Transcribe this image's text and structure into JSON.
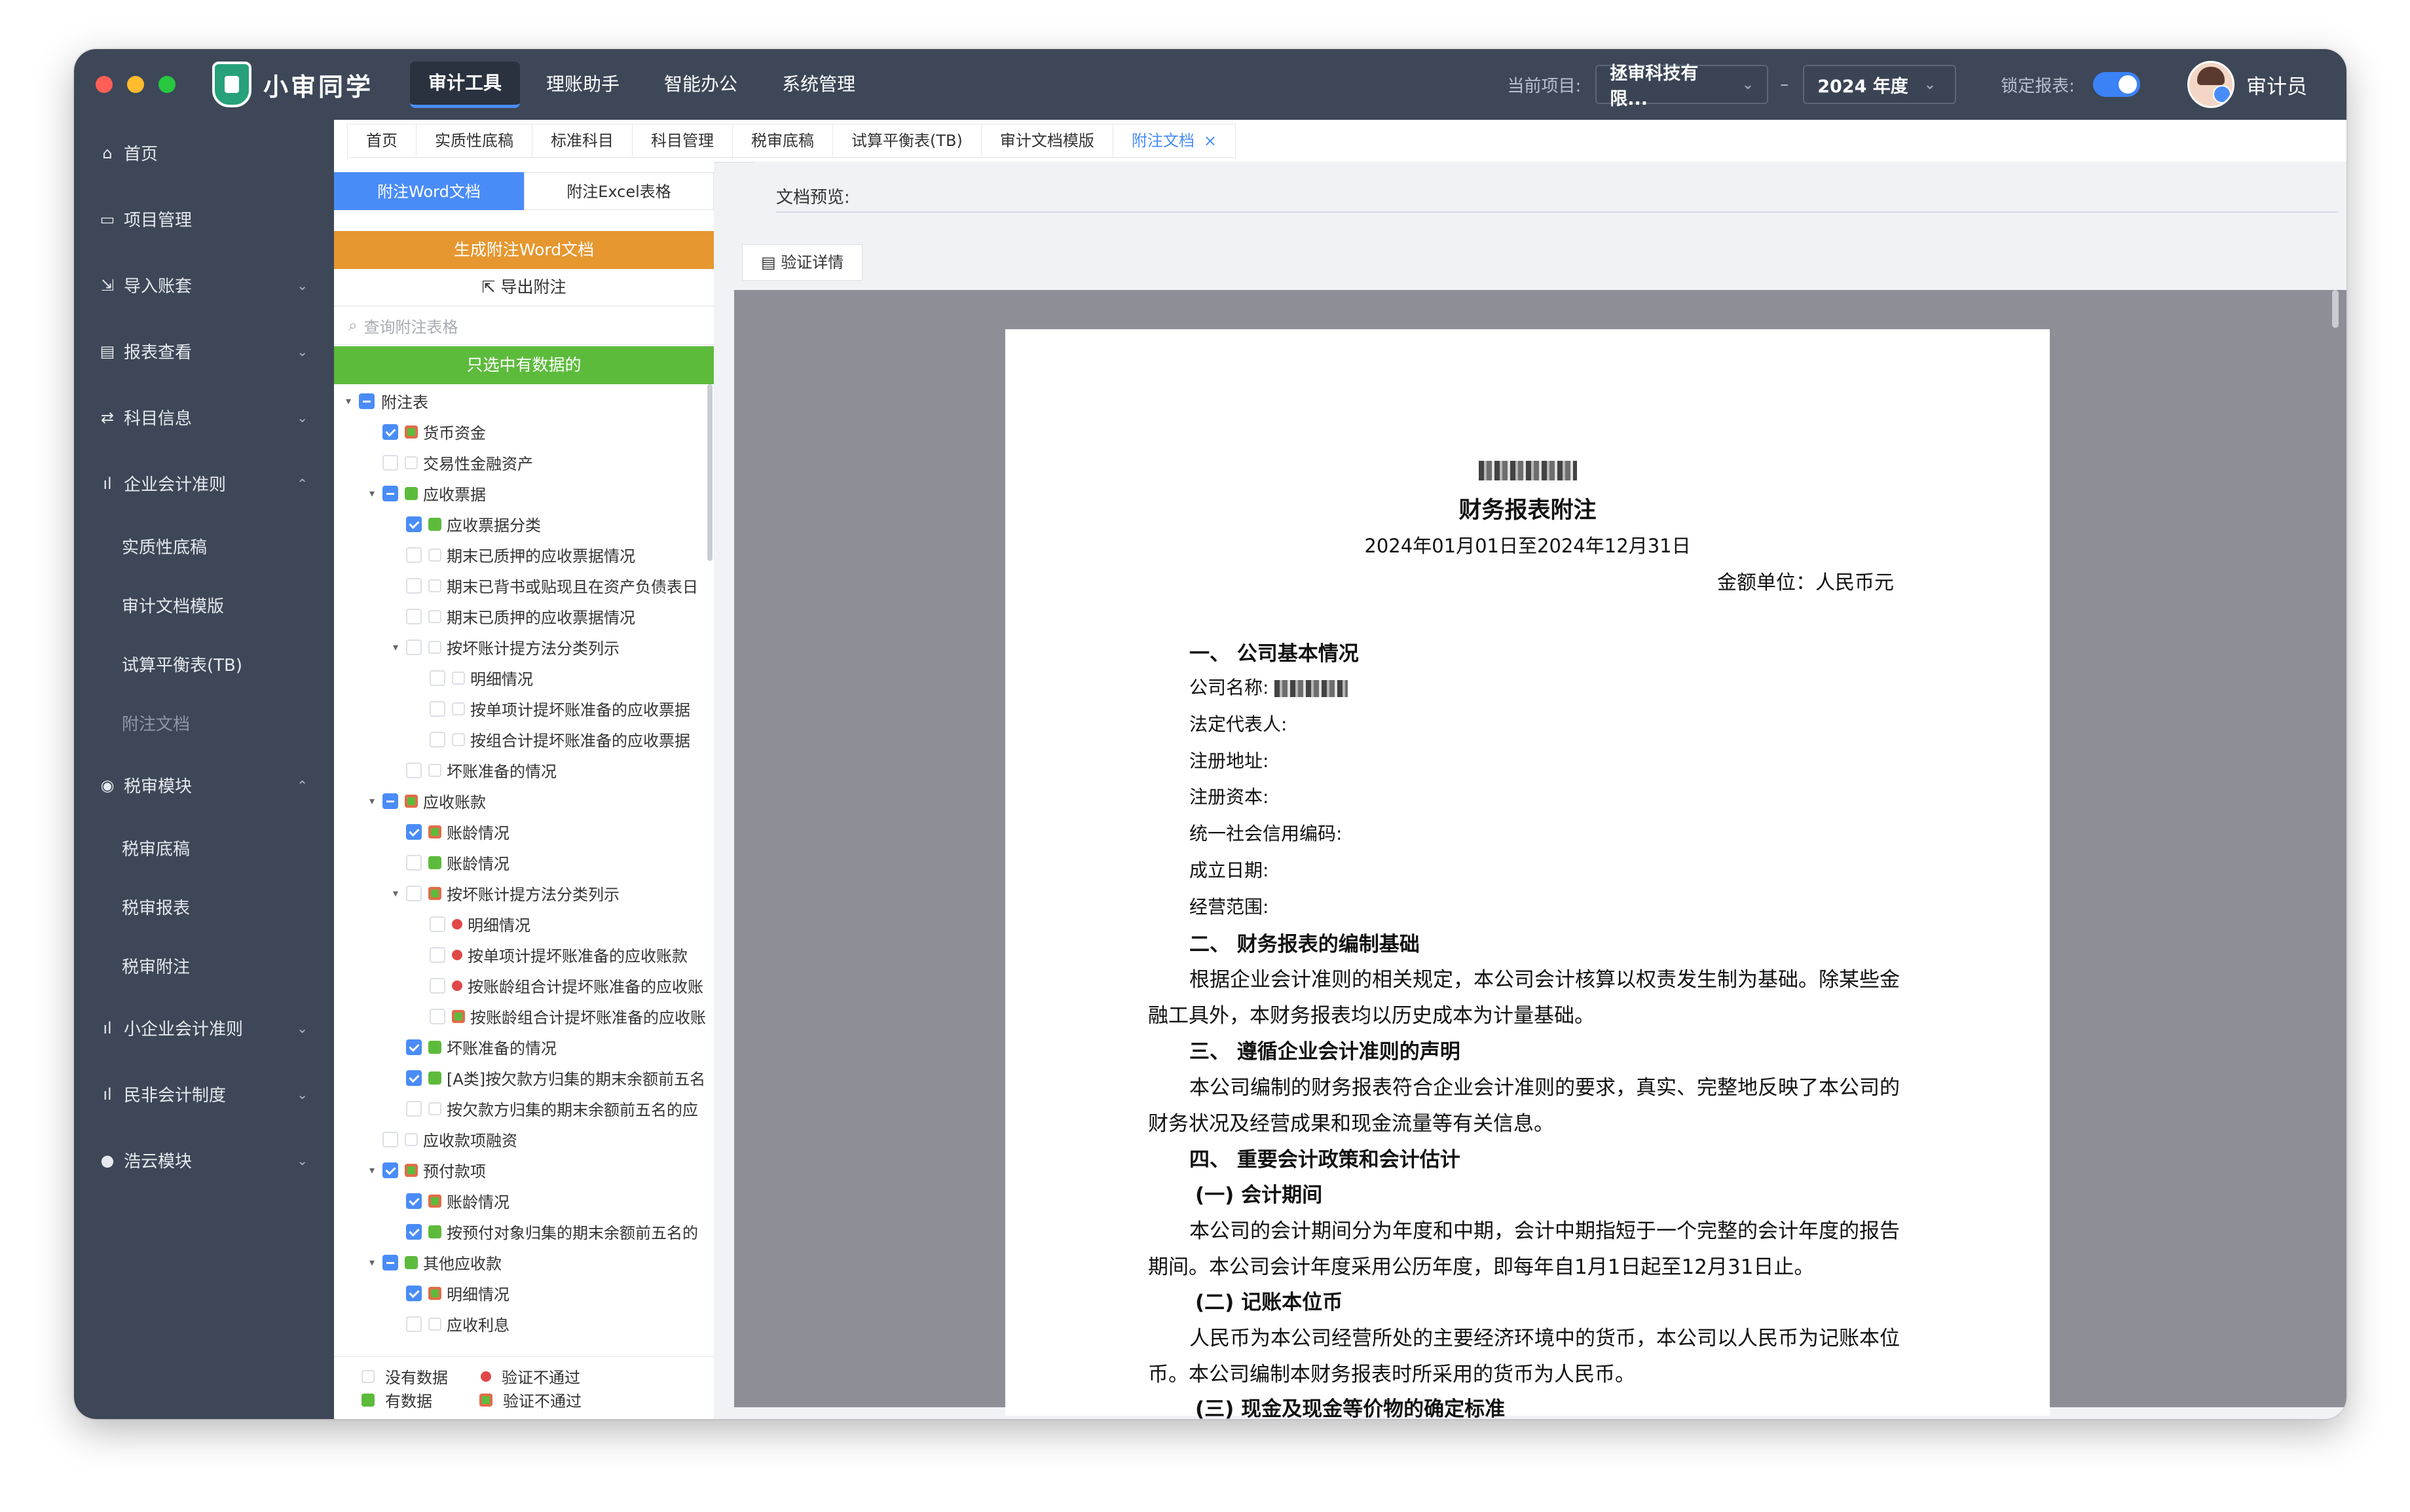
{
  "app": {
    "name": "小审同学",
    "top_nav": [
      "审计工具",
      "理账助手",
      "智能办公",
      "系统管理"
    ],
    "active_top_nav": "审计工具",
    "current_project_label": "当前项目:",
    "current_project_value": "拯审科技有限...",
    "year_value": "2024 年度",
    "dash": "–",
    "lock_label": "锁定报表:",
    "lock_on": true,
    "user_name": "审计员",
    "colors": {
      "header_bg": "#3d4757",
      "accent": "#4a8cf7",
      "orange": "#e6972f",
      "green": "#5dbb3c",
      "red": "#e04848"
    }
  },
  "sidebar": {
    "items": [
      {
        "icon": "home-icon",
        "label": "首页"
      },
      {
        "icon": "folder-icon",
        "label": "项目管理"
      },
      {
        "icon": "import-icon",
        "label": "导入账套",
        "arrow": "⌄"
      },
      {
        "icon": "report-icon",
        "label": "报表查看",
        "arrow": "⌄"
      },
      {
        "icon": "subject-icon",
        "label": "科目信息",
        "arrow": "⌄"
      },
      {
        "icon": "chart-icon",
        "label": "企业会计准则",
        "arrow": "⌃"
      }
    ],
    "sub_standard": [
      "实质性底稿",
      "审计文档模版",
      "试算平衡表(TB)",
      "附注文档"
    ],
    "tax": {
      "icon": "tax-icon",
      "label": "税审模块",
      "arrow": "⌃"
    },
    "sub_tax": [
      "税审底稿",
      "税审报表",
      "税审附注"
    ],
    "bottom_items": [
      {
        "icon": "chart-icon",
        "label": "小企业会计准则",
        "arrow": "⌄"
      },
      {
        "icon": "chart-icon",
        "label": "民非会计制度",
        "arrow": "⌄"
      },
      {
        "icon": "user-icon",
        "label": "浩云模块",
        "arrow": "⌄"
      }
    ]
  },
  "tabs": [
    "首页",
    "实质性底稿",
    "标准科目",
    "科目管理",
    "税审底稿",
    "试算平衡表(TB)",
    "审计文档模版",
    "附注文档"
  ],
  "active_tab": "附注文档",
  "tab_close": "×",
  "panel": {
    "subtabs": [
      "附注Word文档",
      "附注Excel表格"
    ],
    "generate_btn": "生成附注Word文档",
    "export_btn": "导出附注",
    "search_placeholder": "查询附注表格",
    "filter_btn": "只选中有数据的",
    "tree": [
      {
        "level": 0,
        "caret": "▾",
        "cb": "partial",
        "dot": "",
        "label": "附注表"
      },
      {
        "level": 1,
        "caret": "",
        "cb": "checked",
        "dot": "gr",
        "label": "货币资金"
      },
      {
        "level": 1,
        "caret": "",
        "cb": "none",
        "dot": "none",
        "label": "交易性金融资产"
      },
      {
        "level": 1,
        "caret": "▾",
        "cb": "partial",
        "dot": "g",
        "label": "应收票据"
      },
      {
        "level": 2,
        "caret": "",
        "cb": "checked",
        "dot": "g",
        "label": "应收票据分类"
      },
      {
        "level": 2,
        "caret": "",
        "cb": "none",
        "dot": "none",
        "label": "期末已质押的应收票据情况"
      },
      {
        "level": 2,
        "caret": "",
        "cb": "none",
        "dot": "none",
        "label": "期末已背书或贴现且在资产负债表日"
      },
      {
        "level": 2,
        "caret": "",
        "cb": "none",
        "dot": "none",
        "label": "期末已质押的应收票据情况"
      },
      {
        "level": 2,
        "caret": "▾",
        "cb": "none",
        "dot": "none",
        "label": "按坏账计提方法分类列示"
      },
      {
        "level": 3,
        "caret": "",
        "cb": "none",
        "dot": "none",
        "label": "明细情况"
      },
      {
        "level": 3,
        "caret": "",
        "cb": "none",
        "dot": "none",
        "label": "按单项计提坏账准备的应收票据"
      },
      {
        "level": 3,
        "caret": "",
        "cb": "none",
        "dot": "none",
        "label": "按组合计提坏账准备的应收票据"
      },
      {
        "level": 2,
        "caret": "",
        "cb": "none",
        "dot": "none",
        "label": "坏账准备的情况"
      },
      {
        "level": 1,
        "caret": "▾",
        "cb": "partial",
        "dot": "gr",
        "label": "应收账款"
      },
      {
        "level": 2,
        "caret": "",
        "cb": "checked",
        "dot": "gr",
        "label": "账龄情况"
      },
      {
        "level": 2,
        "caret": "",
        "cb": "none",
        "dot": "g",
        "label": "账龄情况"
      },
      {
        "level": 2,
        "caret": "▾",
        "cb": "none",
        "dot": "gr",
        "label": "按坏账计提方法分类列示"
      },
      {
        "level": 3,
        "caret": "",
        "cb": "none",
        "dot": "r",
        "label": "明细情况"
      },
      {
        "level": 3,
        "caret": "",
        "cb": "none",
        "dot": "r",
        "label": "按单项计提坏账准备的应收账款"
      },
      {
        "level": 3,
        "caret": "",
        "cb": "none",
        "dot": "r",
        "label": "按账龄组合计提坏账准备的应收账"
      },
      {
        "level": 3,
        "caret": "",
        "cb": "none",
        "dot": "gr",
        "label": "按账龄组合计提坏账准备的应收账"
      },
      {
        "level": 2,
        "caret": "",
        "cb": "checked",
        "dot": "g",
        "label": "坏账准备的情况"
      },
      {
        "level": 2,
        "caret": "",
        "cb": "checked",
        "dot": "g",
        "label": "[A类]按欠款方归集的期末余额前五名"
      },
      {
        "level": 2,
        "caret": "",
        "cb": "none",
        "dot": "none",
        "label": "按欠款方归集的期末余额前五名的应"
      },
      {
        "level": 1,
        "caret": "",
        "cb": "none",
        "dot": "none",
        "label": "应收款项融资"
      },
      {
        "level": 1,
        "caret": "▾",
        "cb": "checked",
        "dot": "gr",
        "label": "预付款项"
      },
      {
        "level": 2,
        "caret": "",
        "cb": "checked",
        "dot": "gr",
        "label": "账龄情况"
      },
      {
        "level": 2,
        "caret": "",
        "cb": "checked",
        "dot": "g",
        "label": "按预付对象归集的期末余额前五名的"
      },
      {
        "level": 1,
        "caret": "▾",
        "cb": "partial",
        "dot": "g",
        "label": "其他应收款"
      },
      {
        "level": 2,
        "caret": "",
        "cb": "checked",
        "dot": "gr",
        "label": "明细情况"
      },
      {
        "level": 2,
        "caret": "",
        "cb": "none",
        "dot": "none",
        "label": "应收利息"
      }
    ],
    "legend": {
      "no_data": "没有数据",
      "has_data": "有数据",
      "fail_1": "验证不通过",
      "fail_2": "验证不通过"
    }
  },
  "preview": {
    "label": "文档预览:",
    "verify_btn": "验证详情",
    "doc": {
      "title": "财务报表附注",
      "period": "2024年01月01日至2024年12月31日",
      "unit": "金额单位：人民币元",
      "s1": "一、 公司基本情况",
      "company_name_label": "公司名称:",
      "legal_rep": "法定代表人:",
      "reg_address": "注册地址:",
      "reg_capital": "注册资本:",
      "credit_code": "统一社会信用编码:",
      "est_date": "成立日期:",
      "biz_scope": "经营范围:",
      "s2": "二、 财务报表的编制基础",
      "p2a": "根据企业会计准则的相关规定，本公司会计核算以权责发生制为基础。除某些金",
      "p2b": "融工具外，本财务报表均以历史成本为计量基础。",
      "s3": "三、 遵循企业会计准则的声明",
      "p3a": "本公司编制的财务报表符合企业会计准则的要求，真实、完整地反映了本公司的",
      "p3b": "财务状况及经营成果和现金流量等有关信息。",
      "s4": "四、 重要会计政策和会计估计",
      "s4_1": "(一) 会计期间",
      "p41a": "本公司的会计期间分为年度和中期，会计中期指短于一个完整的会计年度的报告",
      "p41b": "期间。本公司会计年度采用公历年度，即每年自1月1日起至12月31日止。",
      "s4_2": "(二) 记账本位币",
      "p42a": "人民币为本公司经营所处的主要经济环境中的货币，本公司以人民币为记账本位",
      "p42b": "币。本公司编制本财务报表时所采用的货币为人民币。",
      "s4_3": "(三) 现金及现金等价物的确定标准"
    }
  }
}
